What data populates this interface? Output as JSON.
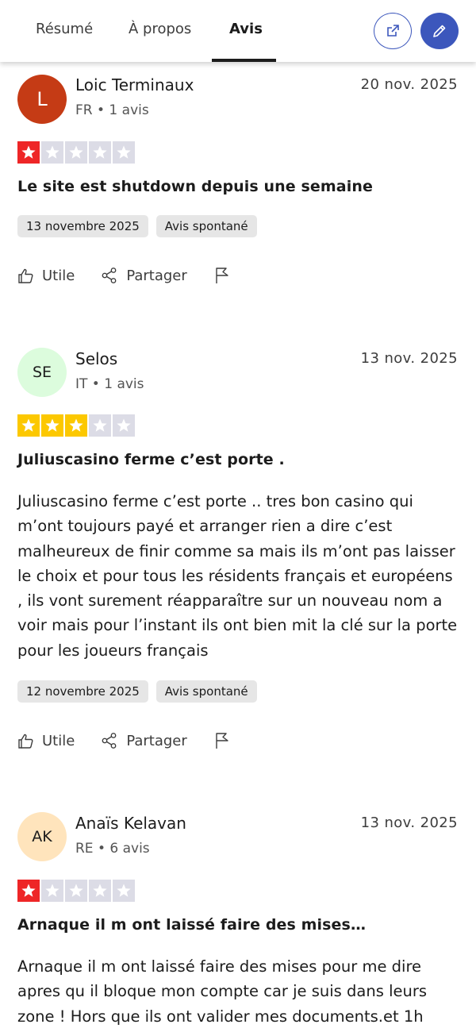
{
  "tabs": [
    "Résumé",
    "À propos",
    "Avis"
  ],
  "active_tab": "Avis",
  "colors": {
    "accent": "#3c57bc",
    "star_red": "#ee2627",
    "star_yellow": "#fcc800",
    "star_empty": "#dcdce6"
  },
  "reviews": [
    {
      "initials": "L",
      "avatar_bg": "#c53b15",
      "avatar_color": "#ffffff",
      "name": "Loic Terminaux",
      "meta": "FR • 1 avis",
      "date": "20 nov. 2025",
      "rating": 1,
      "title": "Le site est shutdown depuis une semaine",
      "body": "",
      "experience_date": "13 novembre 2025",
      "badge": "Avis spontané",
      "useful_label": "Utile",
      "share_label": "Partager"
    },
    {
      "initials": "SE",
      "avatar_bg": "#dcfcdd",
      "avatar_color": "#1c1c1c",
      "name": "Selos",
      "meta": "IT • 1 avis",
      "date": "13 nov. 2025",
      "rating": 3,
      "title": "Juliuscasino ferme c’est porte .",
      "body": "Juliuscasino ferme c’est porte .. tres bon casino qui m’ont toujours payé et arranger rien a dire c’est malheureux de finir comme sa mais ils m’ont pas laisser le choix et pour tous les résidents français et européens , ils vont surement réapparaître sur un nouveau nom a voir mais pour l’instant ils ont bien mit la clé sur la porte pour les joueurs français",
      "experience_date": "12 novembre 2025",
      "badge": "Avis spontané",
      "useful_label": "Utile",
      "share_label": "Partager"
    },
    {
      "initials": "AK",
      "avatar_bg": "#ffe4bc",
      "avatar_color": "#1c1c1c",
      "name": "Anaïs Kelavan",
      "meta": "RE • 6 avis",
      "date": "13 nov. 2025",
      "rating": 1,
      "title": "Arnaque il m ont laissé faire des mises…",
      "body": "Arnaque il m ont laissé faire des mises pour me dire apres qu il bloque mon compte car je suis dans leurs zone ! Hors que ils ont valider mes documents.et 1h",
      "experience_date": "",
      "badge": "",
      "useful_label": "",
      "share_label": ""
    }
  ],
  "icons": {
    "external": "external-link-icon",
    "edit": "pencil-icon",
    "useful": "thumbs-up-icon",
    "share": "share-icon",
    "flag": "flag-icon",
    "star": "star-icon"
  }
}
